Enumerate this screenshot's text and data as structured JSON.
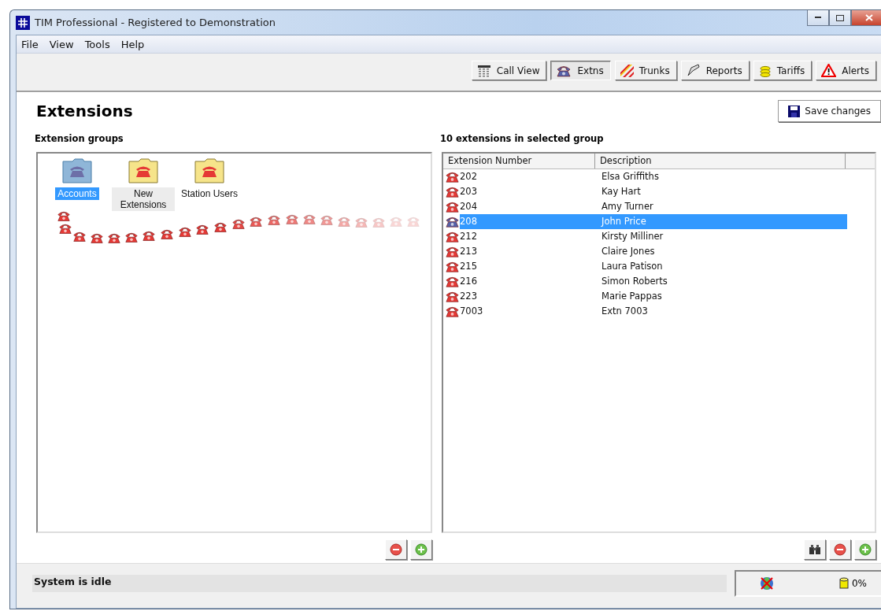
{
  "window": {
    "title": "TIM Professional - Registered to Demonstration"
  },
  "menu": [
    "File",
    "View",
    "Tools",
    "Help"
  ],
  "toolbar": [
    {
      "label": "Call View",
      "kind": "grid",
      "selected": false
    },
    {
      "label": "Extns",
      "kind": "phone",
      "selected": true
    },
    {
      "label": "Trunks",
      "kind": "stripes",
      "selected": false
    },
    {
      "label": "Reports",
      "kind": "pen",
      "selected": false
    },
    {
      "label": "Tariffs",
      "kind": "coins",
      "selected": false
    },
    {
      "label": "Alerts",
      "kind": "warning",
      "selected": false
    }
  ],
  "page": {
    "title": "Extensions",
    "save_button": "Save changes"
  },
  "groups_panel": {
    "heading": "Extension groups",
    "groups": [
      {
        "label": "Accounts",
        "selected": true,
        "hot": false
      },
      {
        "label": "New Extensions",
        "selected": false,
        "hot": true
      },
      {
        "label": "Station Users",
        "selected": false,
        "hot": false
      }
    ]
  },
  "extensions_panel": {
    "heading": "10 extensions in selected group",
    "columns": [
      "Extension Number",
      "Description"
    ],
    "rows": [
      {
        "number": "202",
        "description": "Elsa Griffiths",
        "selected": false
      },
      {
        "number": "203",
        "description": "Kay Hart",
        "selected": false
      },
      {
        "number": "204",
        "description": "Amy Turner",
        "selected": false
      },
      {
        "number": "208",
        "description": "John Price",
        "selected": true
      },
      {
        "number": "212",
        "description": "Kirsty Milliner",
        "selected": false
      },
      {
        "number": "213",
        "description": "Claire Jones",
        "selected": false
      },
      {
        "number": "215",
        "description": "Laura Patison",
        "selected": false
      },
      {
        "number": "216",
        "description": "Simon Roberts",
        "selected": false
      },
      {
        "number": "223",
        "description": "Marie Pappas",
        "selected": false
      },
      {
        "number": "7003",
        "description": "Extn 7003",
        "selected": false
      }
    ]
  },
  "status_bar": {
    "message": "System is idle",
    "progress": "0%"
  }
}
